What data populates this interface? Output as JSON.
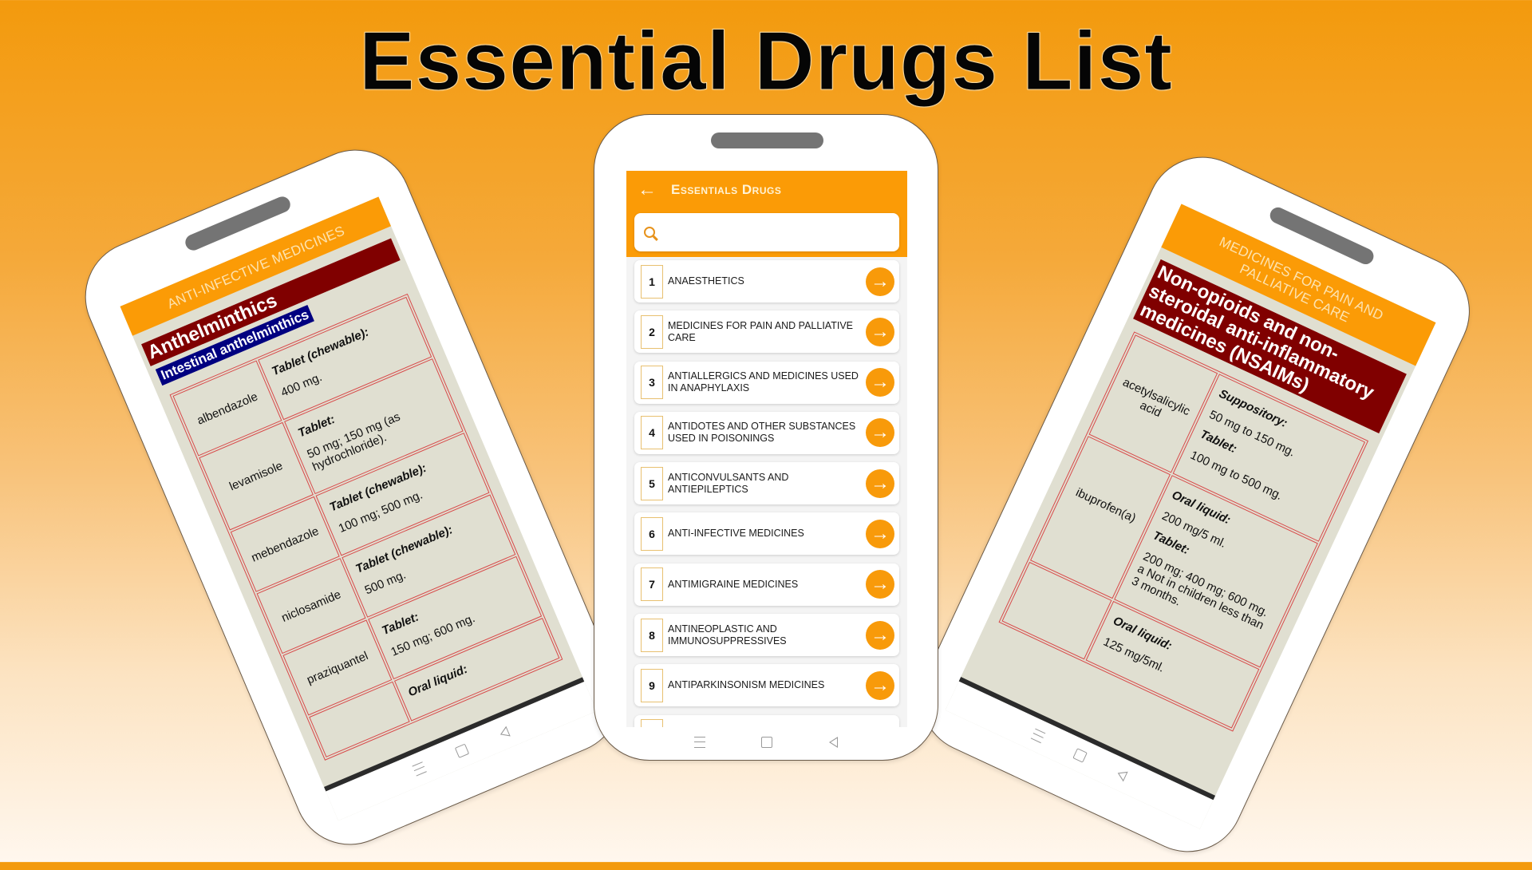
{
  "page": {
    "title": "Essential Drugs List"
  },
  "colors": {
    "accent": "#fb9b06",
    "section_bg": "#800000",
    "subsection_bg": "#000080",
    "table_border": "#d84a4a",
    "detail_bg": "#e0dfd1"
  },
  "center_phone": {
    "appbar": {
      "back_icon": "arrow-left-icon",
      "title": "Essentials Drugs"
    },
    "search": {
      "icon": "search-icon",
      "placeholder": "",
      "value": ""
    },
    "categories": [
      {
        "number": "1",
        "label": "ANAESTHETICS"
      },
      {
        "number": "2",
        "label": "MEDICINES FOR PAIN AND PALLIATIVE CARE"
      },
      {
        "number": "3",
        "label": "ANTIALLERGICS AND MEDICINES USED IN ANAPHYLAXIS"
      },
      {
        "number": "4",
        "label": "ANTIDOTES AND OTHER SUBSTANCES USED IN POISONINGS"
      },
      {
        "number": "5",
        "label": "ANTICONVULSANTS AND ANTIEPILEPTICS"
      },
      {
        "number": "6",
        "label": "ANTI-INFECTIVE MEDICINES"
      },
      {
        "number": "7",
        "label": "ANTIMIGRAINE MEDICINES"
      },
      {
        "number": "8",
        "label": "ANTINEOPLASTIC AND IMMUNOSUPPRESSIVES"
      },
      {
        "number": "9",
        "label": "ANTIPARKINSONISM MEDICINES"
      }
    ],
    "item_action_icon": "arrow-right-circle-icon",
    "nav": [
      "menu-icon",
      "home-icon",
      "back-icon"
    ]
  },
  "left_phone": {
    "category": "ANTI-INFECTIVE MEDICINES",
    "section": "Anthelminthics",
    "subsection": "Intestinal anthelminthics",
    "rows": [
      {
        "name": "albendazole",
        "forms": [
          {
            "form": "Tablet (chewable):",
            "strength": "400 mg."
          }
        ]
      },
      {
        "name": "levamisole",
        "forms": [
          {
            "form": "Tablet:",
            "strength": "50 mg; 150 mg (as hydrochloride)."
          }
        ]
      },
      {
        "name": "mebendazole",
        "forms": [
          {
            "form": "Tablet (chewable):",
            "strength": "100 mg; 500 mg."
          }
        ]
      },
      {
        "name": "niclosamide",
        "forms": [
          {
            "form": "Tablet (chewable):",
            "strength": "500 mg."
          }
        ]
      },
      {
        "name": "praziquantel",
        "forms": [
          {
            "form": "Tablet:",
            "strength": "150 mg; 600 mg."
          }
        ]
      },
      {
        "name": "",
        "forms": [
          {
            "form": "Oral liquid:",
            "strength": ""
          }
        ]
      }
    ]
  },
  "right_phone": {
    "category": "MEDICINES FOR PAIN AND PALLIATIVE CARE",
    "section": "Non-opioids and non-steroidal anti-inflammatory medicines (NSAIMs)",
    "rows": [
      {
        "name": "acetylsalicylic acid",
        "forms": [
          {
            "form": "Suppository:",
            "strength": "50 mg to 150 mg."
          },
          {
            "form": "Tablet:",
            "strength": "100 mg to 500 mg."
          }
        ]
      },
      {
        "name": "ibuprofen(a)",
        "forms": [
          {
            "form": "Oral liquid:",
            "strength": "200 mg/5 ml."
          },
          {
            "form": "Tablet:",
            "strength": "200 mg; 400 mg; 600 mg. a Not in children less than 3 months."
          }
        ]
      },
      {
        "name": "",
        "forms": [
          {
            "form": "Oral liquid:",
            "strength": "125 mg/5ml."
          }
        ]
      }
    ]
  }
}
